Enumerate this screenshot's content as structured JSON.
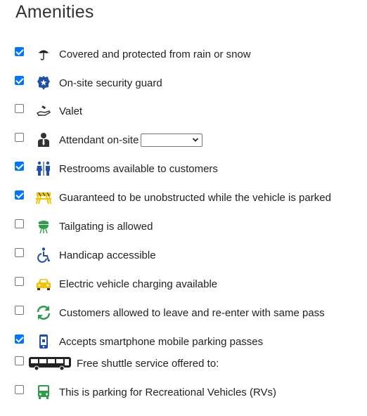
{
  "title": "Amenities",
  "amenities": [
    {
      "label": "Covered and protected from rain or snow",
      "checked": true,
      "icon": "umbrella-icon"
    },
    {
      "label": "On-site security guard",
      "checked": true,
      "icon": "police-badge-icon"
    },
    {
      "label": "Valet",
      "checked": false,
      "icon": "hand-key-icon"
    },
    {
      "label": "Attendant on-site",
      "checked": false,
      "icon": "attendant-icon",
      "select_value": ""
    },
    {
      "label": "Restrooms available to customers",
      "checked": true,
      "icon": "restroom-icon"
    },
    {
      "label": "Guaranteed to be unobstructed while the vehicle is parked",
      "checked": true,
      "icon": "barricade-icon"
    },
    {
      "label": "Tailgating is allowed",
      "checked": false,
      "icon": "grill-icon"
    },
    {
      "label": "Handicap accessible",
      "checked": false,
      "icon": "wheelchair-icon"
    },
    {
      "label": "Electric vehicle charging available",
      "checked": false,
      "icon": "car-icon"
    },
    {
      "label": "Customers allowed to leave and re-enter with same pass",
      "checked": false,
      "icon": "refresh-icon"
    },
    {
      "label": "Accepts smartphone mobile parking passes",
      "checked": true,
      "icon": "smartphone-icon"
    },
    {
      "label": "Free shuttle service offered to:",
      "checked": false,
      "icon": "bus-icon"
    },
    {
      "label": "This is parking for Recreational Vehicles (RVs)",
      "checked": false,
      "icon": "rv-icon"
    }
  ],
  "colors": {
    "checkbox_checked": "#0075ff",
    "icon_blue": "#1f4fa8",
    "icon_green": "#2e9e4a",
    "icon_yellow": "#f2c400"
  }
}
